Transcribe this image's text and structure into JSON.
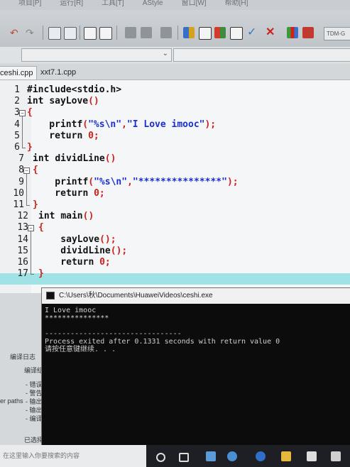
{
  "menubar": {
    "items": [
      "项目[P]",
      "运行[R]",
      "工具[T]",
      "AStyle",
      "窗口[W]",
      "帮助[H]"
    ]
  },
  "toolbar": {
    "compiler_combo": "TDM-G"
  },
  "tabs": [
    {
      "label": "ceshi.cpp",
      "active": true
    },
    {
      "label": "xxt7.1.cpp",
      "active": false
    }
  ],
  "editor": {
    "lines": [
      {
        "n": "1",
        "parts": [
          {
            "t": "#include<stdio.h>",
            "c": "kw"
          }
        ]
      },
      {
        "n": "2",
        "parts": [
          {
            "t": "int ",
            "c": "kw"
          },
          {
            "t": "sayLove",
            "c": "kw"
          },
          {
            "t": "()",
            "c": "pn"
          }
        ]
      },
      {
        "n": "3",
        "parts": [
          {
            "t": "{",
            "c": "pn"
          }
        ]
      },
      {
        "n": "4",
        "parts": [
          {
            "t": "    printf",
            "c": "kw"
          },
          {
            "t": "(",
            "c": "pn"
          },
          {
            "t": "\"%s\\n\"",
            "c": "str"
          },
          {
            "t": ",",
            "c": "pn"
          },
          {
            "t": "\"I Love imooc\"",
            "c": "str"
          },
          {
            "t": ");",
            "c": "pn"
          }
        ]
      },
      {
        "n": "5",
        "parts": [
          {
            "t": "    return ",
            "c": "kw"
          },
          {
            "t": "0",
            "c": "num"
          },
          {
            "t": ";",
            "c": "pn"
          }
        ]
      },
      {
        "n": "6",
        "parts": [
          {
            "t": "}",
            "c": "pn"
          }
        ]
      },
      {
        "n": "7",
        "parts": [
          {
            "t": "int ",
            "c": "kw"
          },
          {
            "t": "dividLine",
            "c": "kw"
          },
          {
            "t": "()",
            "c": "pn"
          }
        ]
      },
      {
        "n": "8",
        "parts": [
          {
            "t": "{",
            "c": "pn"
          }
        ]
      },
      {
        "n": "9",
        "parts": [
          {
            "t": "    printf",
            "c": "kw"
          },
          {
            "t": "(",
            "c": "pn"
          },
          {
            "t": "\"%s\\n\"",
            "c": "str"
          },
          {
            "t": ",",
            "c": "pn"
          },
          {
            "t": "\"***************\"",
            "c": "str"
          },
          {
            "t": ");",
            "c": "pn"
          }
        ]
      },
      {
        "n": "10",
        "parts": [
          {
            "t": "    return ",
            "c": "kw"
          },
          {
            "t": "0",
            "c": "num"
          },
          {
            "t": ";",
            "c": "pn"
          }
        ]
      },
      {
        "n": "11",
        "parts": [
          {
            "t": "}",
            "c": "pn"
          }
        ]
      },
      {
        "n": "12",
        "parts": [
          {
            "t": "int ",
            "c": "kw"
          },
          {
            "t": "main",
            "c": "kw"
          },
          {
            "t": "()",
            "c": "pn"
          }
        ]
      },
      {
        "n": "13",
        "parts": [
          {
            "t": "{",
            "c": "pn"
          }
        ]
      },
      {
        "n": "14",
        "parts": [
          {
            "t": "    sayLove",
            "c": "kw"
          },
          {
            "t": "();",
            "c": "pn"
          }
        ]
      },
      {
        "n": "15",
        "parts": [
          {
            "t": "    dividLine",
            "c": "kw"
          },
          {
            "t": "();",
            "c": "pn"
          }
        ]
      },
      {
        "n": "16",
        "parts": [
          {
            "t": "    return ",
            "c": "kw"
          },
          {
            "t": "0",
            "c": "num"
          },
          {
            "t": ";",
            "c": "pn"
          }
        ]
      },
      {
        "n": "17",
        "parts": [
          {
            "t": "}",
            "c": "pn"
          }
        ]
      }
    ]
  },
  "left_panel": {
    "tab_label": "编译日志",
    "header": "编译结果",
    "items": [
      "- 错误",
      "- 警告",
      "- 输出",
      "- 输出",
      "- 编译"
    ],
    "paths_label": "er paths",
    "status": "已选择"
  },
  "console": {
    "title": "C:\\Users\\秋\\Documents\\HuaweiVideos\\ceshi.exe",
    "lines": [
      "I Love imooc",
      "***************",
      "",
      "--------------------------------",
      "Process exited after 0.1331 seconds with return value 0",
      "请按任意键继续. . ."
    ]
  },
  "taskbar": {
    "search_placeholder": "在这里输入你要搜索的内容"
  },
  "colors": {
    "editor_bg": "#f4f6f7",
    "highlight_line": "#9fe3e6",
    "string": "#1b2fd0",
    "number": "#d0201b",
    "console_bg": "#0c0c0c"
  }
}
